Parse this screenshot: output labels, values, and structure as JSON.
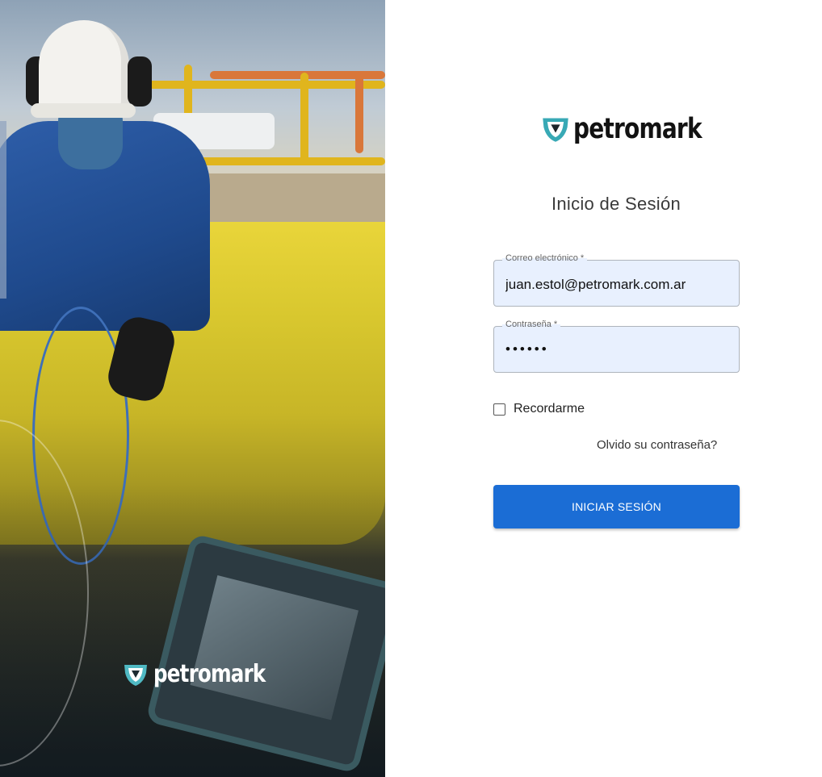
{
  "brand": {
    "name": "petromark"
  },
  "hero": {
    "logo_text": "petromark"
  },
  "login": {
    "title": "Inicio de Sesión",
    "email": {
      "label": "Correo electrónico *",
      "value": "juan.estol@petromark.com.ar"
    },
    "password": {
      "label": "Contraseña *",
      "value": "••••••"
    },
    "remember_label": "Recordarme",
    "remember_checked": false,
    "forgot_link": "Olvido su contraseña?",
    "submit_label": "INICIAR SESIÓN"
  },
  "colors": {
    "primary": "#1b6dd5",
    "logo_teal": "#38a9b5",
    "field_bg": "#e8f0fe"
  },
  "icons": [
    "petromark-shield-logo-icon",
    "checkbox-icon"
  ]
}
